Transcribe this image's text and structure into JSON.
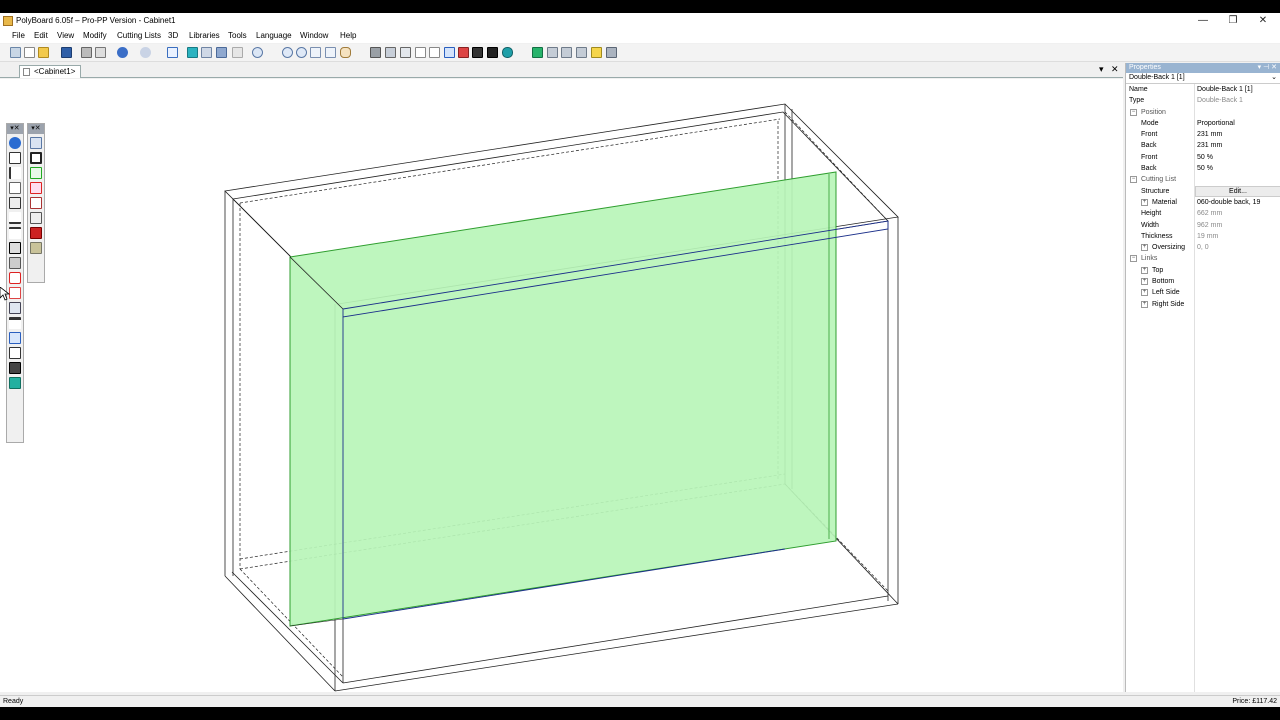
{
  "window": {
    "title": "PolyBoard 6.05f – Pro-PP Version - Cabinet1",
    "min_glyph": "—",
    "restore_glyph": "❐",
    "close_glyph": "✕"
  },
  "menu": [
    "File",
    "Edit",
    "View",
    "Modify",
    "Cutting Lists",
    "3D",
    "Libraries",
    "Tools",
    "Language",
    "Window",
    "Help"
  ],
  "tabs": {
    "active": "<Cabinet1>",
    "dropdown_glyph": "▾",
    "close_glyph": "✕"
  },
  "palette": {
    "header_glyph": "▾✕"
  },
  "properties": {
    "header": "Properties",
    "header_pin": "▾ ⊣ ✕",
    "selected": "Double-Back 1 [1]",
    "dropdown_glyph": "⌄",
    "rows": {
      "name": {
        "label": "Name",
        "value": "Double-Back 1 [1]"
      },
      "type": {
        "label": "Type",
        "value": "Double-Back 1"
      },
      "position": {
        "label": "Position"
      },
      "mode": {
        "label": "Mode",
        "value": "Proportional"
      },
      "front_mm": {
        "label": "Front",
        "value": "231 mm"
      },
      "back_mm": {
        "label": "Back",
        "value": "231 mm"
      },
      "front_pct": {
        "label": "Front",
        "value": "50 %"
      },
      "back_pct": {
        "label": "Back",
        "value": "50 %"
      },
      "cutting_list": {
        "label": "Cutting List"
      },
      "structure": {
        "label": "Structure",
        "value": "Edit..."
      },
      "material": {
        "label": "Material",
        "value": "060-double back, 19"
      },
      "height": {
        "label": "Height",
        "value": "662 mm"
      },
      "width": {
        "label": "Width",
        "value": "962 mm"
      },
      "thickness": {
        "label": "Thickness",
        "value": "19 mm"
      },
      "oversizing": {
        "label": "Oversizing",
        "value": "0, 0"
      },
      "links": {
        "label": "Links"
      },
      "top": {
        "label": "Top"
      },
      "bottom": {
        "label": "Bottom"
      },
      "left_side": {
        "label": "Left Side"
      },
      "right_side": {
        "label": "Right Side"
      }
    },
    "expand_glyph": "+",
    "collapse_glyph": "−"
  },
  "status": {
    "left": "Ready",
    "price": "Price: £117.42"
  },
  "colors": {
    "panel_fill": "#b9f5b9",
    "panel_edge": "#2f9e2f",
    "title_accent": "#99b4d1"
  }
}
